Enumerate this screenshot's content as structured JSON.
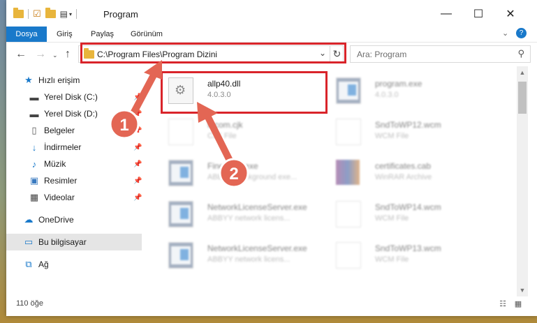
{
  "window": {
    "title": "Program"
  },
  "ribbon": {
    "tabs": [
      "Dosya",
      "Giriş",
      "Paylaş",
      "Görünüm"
    ]
  },
  "address": {
    "path": "C:\\Program Files\\Program Dizini"
  },
  "search": {
    "placeholder": "Ara: Program"
  },
  "sidebar": {
    "items": [
      {
        "label": "Hızlı erişim"
      },
      {
        "label": "Yerel Disk (C:)"
      },
      {
        "label": "Yerel Disk (D:)"
      },
      {
        "label": "Belgeler"
      },
      {
        "label": "İndirmeler"
      },
      {
        "label": "Müzik"
      },
      {
        "label": "Resimler"
      },
      {
        "label": "Videolar"
      },
      {
        "label": "OneDrive"
      },
      {
        "label": "Bu bilgisayar"
      },
      {
        "label": "Ağ"
      }
    ]
  },
  "files": [
    {
      "name": "allp40.dll",
      "sub": "4.0.3.0"
    },
    {
      "name": "program.exe",
      "sub": "4.0.3.0"
    },
    {
      "name": "fncom.cjk",
      "sub": "CJK File"
    },
    {
      "name": "SndToWP12.wcm",
      "sub": "WCM File"
    },
    {
      "name": "FineExec.exe",
      "sub": "ABBYY Background exe..."
    },
    {
      "name": "certificates.cab",
      "sub": "WinRAR Archive"
    },
    {
      "name": "NetworkLicenseServer.exe",
      "sub": "ABBYY network licens..."
    },
    {
      "name": "SndToWP14.wcm",
      "sub": "WCM File"
    },
    {
      "name": "NetworkLicenseServer.exe",
      "sub": "ABBYY network licens..."
    },
    {
      "name": "SndToWP13.wcm",
      "sub": "WCM File"
    }
  ],
  "status": {
    "count": "110 öğe"
  },
  "annotations": {
    "step1": "1",
    "step2": "2"
  },
  "colors": {
    "accent": "#1979ca",
    "highlight": "#d9242a",
    "arrow": "#e36654"
  }
}
